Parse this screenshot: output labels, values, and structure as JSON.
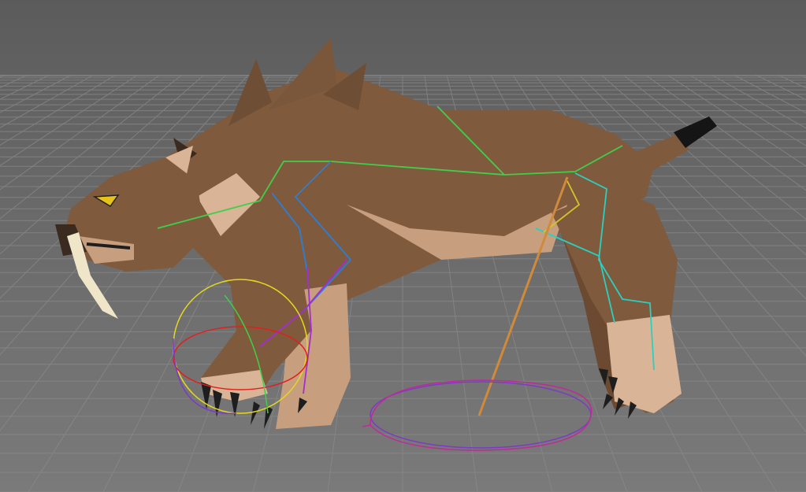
{
  "viewport": {
    "background_color": "#5e5e5e",
    "grid_color": "#8a8a8a",
    "model": {
      "fur_main": "#7f5a3d",
      "fur_dark": "#6b4a31",
      "fur_light": "#c79f7f",
      "fur_pale": "#d9b497",
      "claw": "#1e1e1e",
      "fang": "#efe5c8",
      "eye": "#e6c21a",
      "tail_tip": "#151515"
    },
    "rig": {
      "spine_color": "#3fcf4a",
      "ik_handle_color": "#d08a3c",
      "limb_colors": [
        "#2b7fd6",
        "#a22fd0",
        "#2ad0c0",
        "#d4c32b"
      ],
      "control_colors": [
        "#e3d81f",
        "#e02020",
        "#7b3bc4",
        "#c02a9a"
      ]
    }
  }
}
